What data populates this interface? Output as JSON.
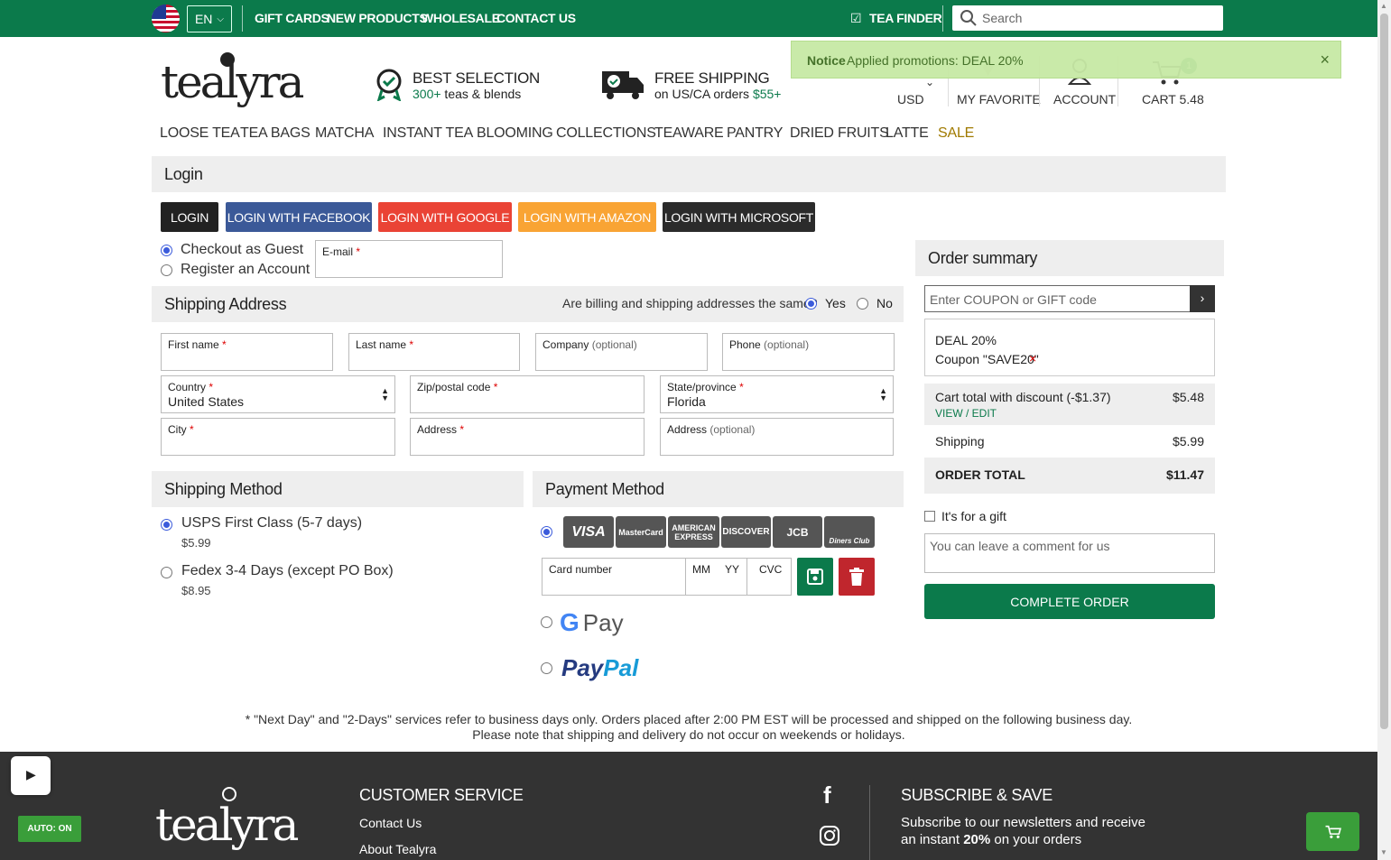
{
  "topbar": {
    "language": "EN",
    "links": [
      "GIFT CARDS",
      "NEW PRODUCTS",
      "WHOLESALE",
      "CONTACT US"
    ],
    "tea_finder": "TEA FINDER",
    "search_placeholder": "Search"
  },
  "header": {
    "logo": "tealyra",
    "feature1_title": "BEST SELECTION",
    "feature1_sub_a": "300+",
    "feature1_sub_b": " teas & blends",
    "feature2_title": "FREE SHIPPING",
    "feature2_sub_a": "on US/CA orders ",
    "feature2_sub_b": "$55+",
    "currency": "USD",
    "favorite": "MY FAVORITE",
    "account": "ACCOUNT",
    "cart": "CART 5.48",
    "cart_count": "1"
  },
  "notice": {
    "label": "Notice",
    "message": "Applied promotions: DEAL 20%",
    "close": "×"
  },
  "nav": [
    "LOOSE TEA",
    "TEA BAGS",
    "MATCHA",
    "INSTANT TEA",
    "BLOOMING",
    "COLLECTIONS",
    "TEAWARE",
    "PANTRY",
    "DRIED FRUITS",
    "LATTE",
    "SALE"
  ],
  "login": {
    "heading": "Login",
    "buttons": [
      "LOGIN",
      "LOGIN WITH FACEBOOK",
      "LOGIN WITH GOOGLE",
      "LOGIN WITH AMAZON",
      "LOGIN WITH MICROSOFT"
    ],
    "guest": "Checkout as Guest",
    "register": "Register an Account",
    "email_label": "E-mail"
  },
  "shipping_address": {
    "heading": "Shipping Address",
    "same_question": "Are billing and shipping addresses the same?",
    "yes": "Yes",
    "no": "No",
    "first_name": "First name",
    "last_name": "Last name",
    "company": "Company",
    "phone": "Phone",
    "optional": "(optional)",
    "country_label": "Country",
    "country_value": "United States",
    "zip": "Zip/postal code",
    "state_label": "State/province",
    "state_value": "Florida",
    "city": "City",
    "address": "Address",
    "required_mark": "*"
  },
  "shipping_method": {
    "heading": "Shipping Method",
    "options": [
      {
        "name": "USPS First Class (5-7 days)",
        "price": "$5.99"
      },
      {
        "name": "Fedex 3-4 Days (except PO Box)",
        "price": "$8.95"
      }
    ]
  },
  "payment": {
    "heading": "Payment Method",
    "cards": [
      "VISA",
      "MasterCard",
      "AMERICAN EXPRESS",
      "DISCOVER",
      "JCB",
      "Diners Club"
    ],
    "card_number": "Card number",
    "mm": "MM",
    "yy": "YY",
    "cvc": "CVC",
    "gpay": "Pay",
    "paypal_a": "Pay",
    "paypal_b": "Pal"
  },
  "summary": {
    "heading": "Order summary",
    "coupon_placeholder": "Enter COUPON or GIFT code",
    "coupon_go": "›",
    "deal": "DEAL 20%",
    "coupon": "Coupon \"SAVE20\"",
    "remove": "×",
    "cart_total_label": "Cart total with discount (-$1.37)",
    "cart_total": "$5.48",
    "view_edit": "VIEW / EDIT",
    "shipping_label": "Shipping",
    "shipping": "$5.99",
    "order_total_label": "ORDER TOTAL",
    "order_total": "$11.47",
    "gift": "It's for a gift",
    "comment_placeholder": "You can leave a comment for us",
    "complete": "COMPLETE ORDER"
  },
  "note": {
    "line1": "* \"Next Day\" and \"2-Days\" services refer to business days only. Orders placed after 2:00 PM EST will be processed and shipped on the following business day.",
    "line2": "Please note that shipping and delivery do not occur on weekends or holidays."
  },
  "footer": {
    "logo": "tealyra",
    "cs_heading": "CUSTOMER SERVICE",
    "links": [
      "Contact Us",
      "About Tealyra"
    ],
    "subscribe_heading": "SUBSCRIBE & SAVE",
    "subscribe_a": "Subscribe to our newsletters and receive",
    "subscribe_b": "an instant ",
    "subscribe_pct": "20%",
    "subscribe_c": " on your orders"
  },
  "widget": {
    "auto": "AUTO: ON"
  }
}
